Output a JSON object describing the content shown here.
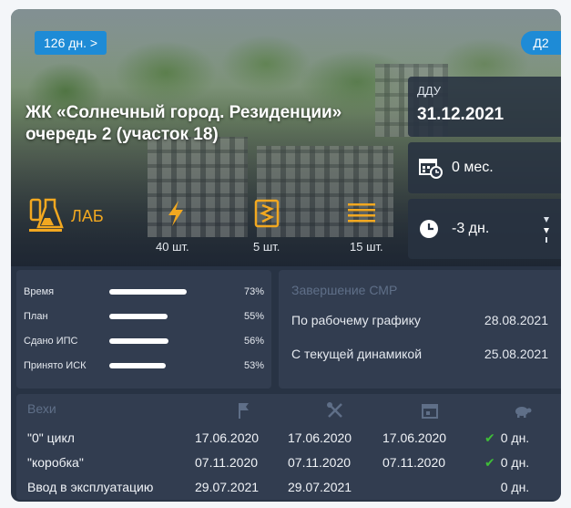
{
  "hero": {
    "days_badge": "126 дн. >",
    "phase_badge": "Д2",
    "title": "ЖК «Солнечный город. Резиденции» очередь 2 (участок 18)",
    "lab_label": "ЛАБ",
    "metrics": [
      {
        "icon": "lightning-icon",
        "value": "40 шт."
      },
      {
        "icon": "document-zigzag-icon",
        "value": "5 шт."
      },
      {
        "icon": "lines-icon",
        "value": "15 шт."
      }
    ],
    "ddu_label": "ДДУ",
    "ddu_date": "31.12.2021",
    "months": "0 мес.",
    "delay": "-3 дн."
  },
  "progress": [
    {
      "label": "Время",
      "percent_text": "73%",
      "value": 0.73
    },
    {
      "label": "План",
      "percent_text": "55%",
      "value": 0.55
    },
    {
      "label": "Сдано ИПС",
      "percent_text": "56%",
      "value": 0.56
    },
    {
      "label": "Принято ИСК",
      "percent_text": "53%",
      "value": 0.53
    }
  ],
  "completion": {
    "title": "Завершение СМР",
    "rows": [
      {
        "label": "По рабочему графику",
        "date": "28.08.2021"
      },
      {
        "label": "С текущей динамикой",
        "date": "25.08.2021"
      }
    ]
  },
  "milestones": {
    "header": "Вехи",
    "header_icons": [
      "flag-icon",
      "tools-icon",
      "calendar-icon",
      "turtle-icon"
    ],
    "rows": [
      {
        "name": "\"0\" цикл",
        "d1": "17.06.2020",
        "d2": "17.06.2020",
        "d3": "17.06.2020",
        "delta": "0 дн.",
        "ok": true
      },
      {
        "name": "\"коробка\"",
        "d1": "07.11.2020",
        "d2": "07.11.2020",
        "d3": "07.11.2020",
        "delta": "0 дн.",
        "ok": true
      },
      {
        "name": "Ввод в эксплуатацию",
        "d1": "29.07.2021",
        "d2": "29.07.2021",
        "d3": "",
        "delta": "0 дн.",
        "ok": false
      }
    ]
  },
  "colors": {
    "accent": "#1e8bd6",
    "lab": "#f2a820",
    "ok": "#3fbd38",
    "panel": "#323d50"
  }
}
